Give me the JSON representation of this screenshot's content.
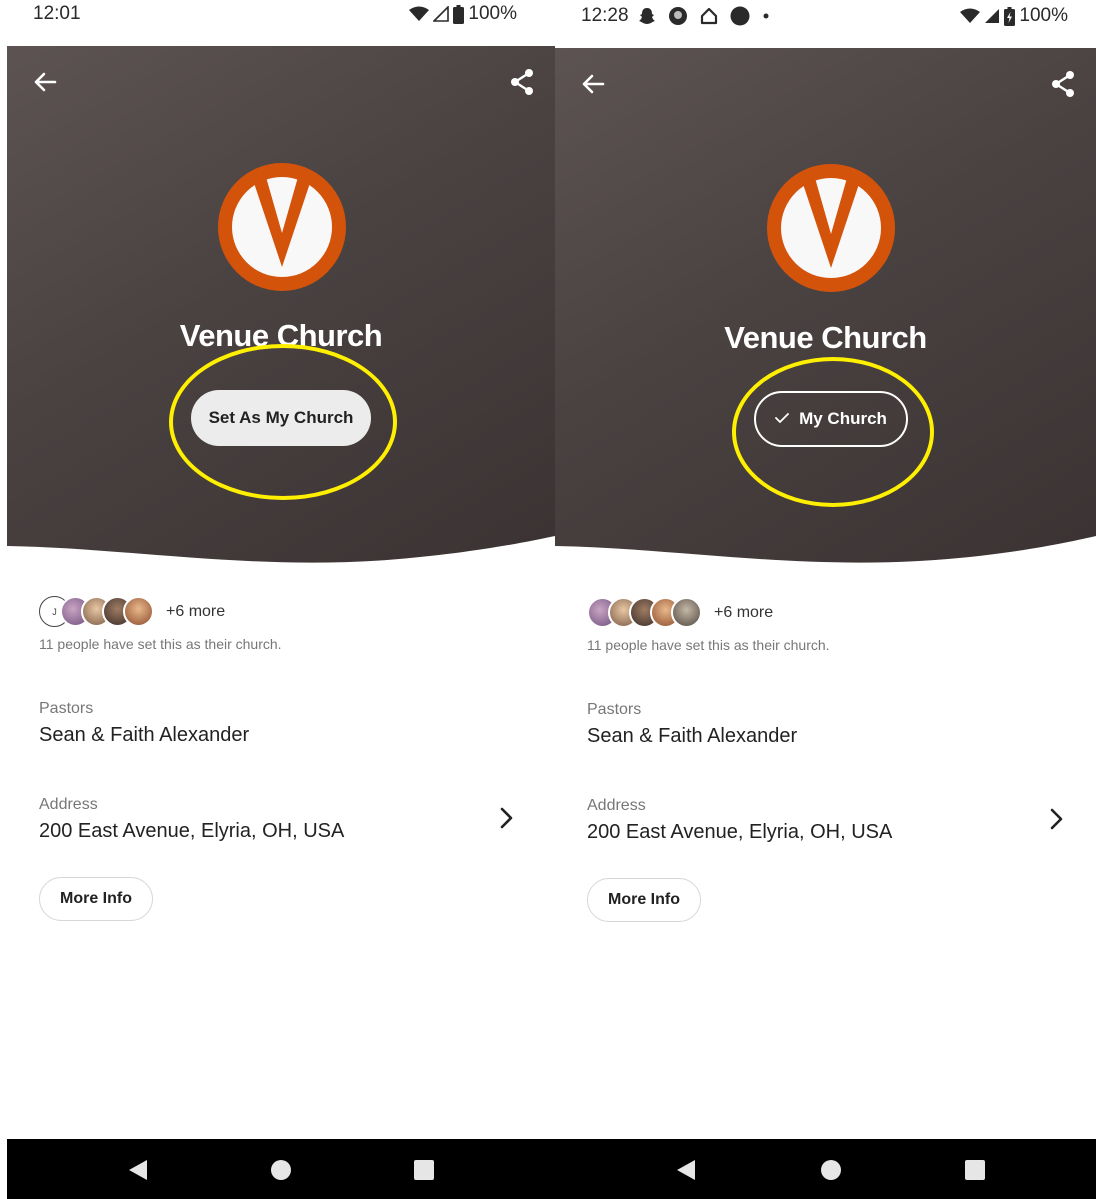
{
  "left": {
    "status": {
      "time": "12:01",
      "battery": "100%"
    },
    "church": {
      "name": "Venue Church"
    },
    "action_button": {
      "label": "Set As My Church"
    },
    "members": {
      "more": "+6 more",
      "caption": "11 people have set this as their church.",
      "initial": "J"
    },
    "pastors": {
      "label": "Pastors",
      "value": "Sean & Faith Alexander"
    },
    "address": {
      "label": "Address",
      "value": "200 East Avenue, Elyria, OH, USA"
    },
    "more_info": {
      "label": "More Info"
    }
  },
  "right": {
    "status": {
      "time": "12:28",
      "battery": "100%"
    },
    "church": {
      "name": "Venue Church"
    },
    "action_button": {
      "label": "My Church"
    },
    "members": {
      "more": "+6 more",
      "caption": "11 people have set this as their church."
    },
    "pastors": {
      "label": "Pastors",
      "value": "Sean & Faith Alexander"
    },
    "address": {
      "label": "Address",
      "value": "200 East Avenue, Elyria, OH, USA"
    },
    "more_info": {
      "label": "More Info"
    }
  },
  "colors": {
    "hero": "#4a4241",
    "logo_orange": "#d4530b",
    "highlight": "#ffef00",
    "nav_bar": "#000000"
  }
}
